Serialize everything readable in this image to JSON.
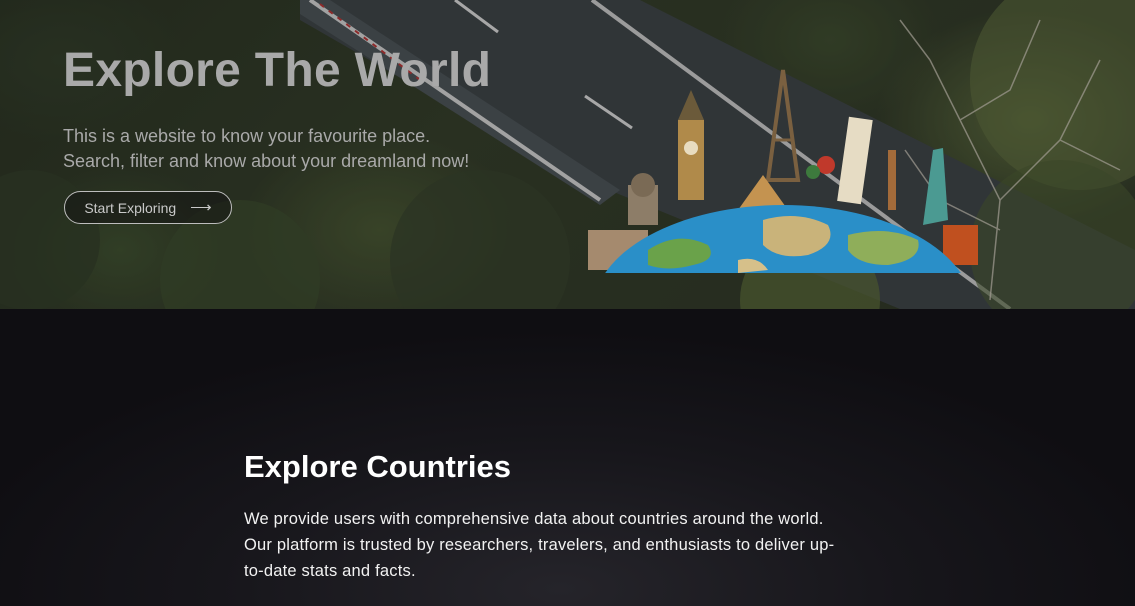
{
  "hero": {
    "title": "Explore The World",
    "subtitle_line1": "This is a website to know your favourite place.",
    "subtitle_line2": "Search, filter and know about your dreamland now!",
    "button_label": "Start Exploring",
    "button_icon": "arrow-right-icon"
  },
  "section": {
    "title": "Explore Countries",
    "body": "We provide users with comprehensive data about countries around the world. Our platform is trusted by researchers, travelers, and enthusiasts to deliver up-to-date stats and facts."
  },
  "colors": {
    "hero_text": "#a9a9a9",
    "section_bg": "#121115",
    "section_text": "#ffffff"
  }
}
